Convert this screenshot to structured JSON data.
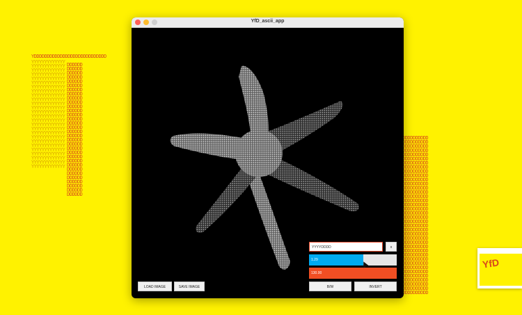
{
  "window": {
    "title": "YfD_ascii_app"
  },
  "background": {
    "ascii_top": "YDDDDDDDDDDDDDDDDDDDDDDDDDDDD",
    "ascii_col_y": "YYYYYYYYYYYYY",
    "ascii_col_d": "DDDDDD",
    "ascii_right": "DDDDDDDDDD",
    "ascii_bottom": "YYDDDDDDDDDD"
  },
  "controls": {
    "text_field_value": "YYYYDDDD",
    "clear_label": "x",
    "slider_value_label": "1.29",
    "slider_fraction": 0.62,
    "red_field_value": "130.00",
    "bw_label": "B/W",
    "invert_label": "INVERT",
    "load_label": "LOAD IMAGE",
    "save_label": "SAVE IMAGE"
  },
  "colors": {
    "background": "#fff200",
    "accent_blue": "#00aaf0",
    "accent_red": "#f04e23",
    "ascii_gold": "#d9a400",
    "ascii_red": "#d84a1b"
  },
  "thumbnail": {
    "label": "YfD"
  }
}
